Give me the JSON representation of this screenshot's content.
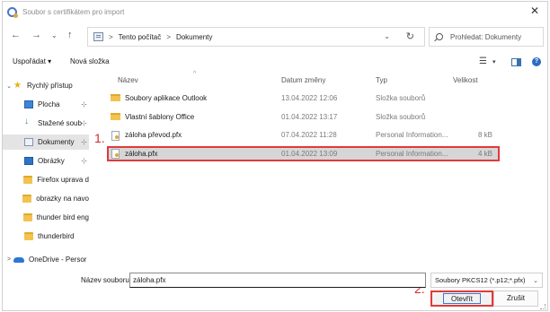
{
  "window": {
    "title": "Soubor s certifikátem pro import",
    "close_glyph": "✕"
  },
  "nav": {
    "back": "←",
    "forward": "→",
    "recent": "⌄",
    "up": "↑",
    "address": {
      "crumb_sep_1": ">",
      "part_1": "Tento počítač",
      "crumb_sep_2": ">",
      "part_2": "Dokumenty",
      "dropdown": "⌄",
      "refresh": "↻"
    },
    "search": {
      "placeholder": "Prohledat: Dokumenty"
    }
  },
  "toolbar": {
    "organize": "Uspořádat ▾",
    "new_folder": "Nová složka",
    "view_glyph": "☰",
    "view_chev": "▾",
    "help_glyph": "?"
  },
  "sidebar": {
    "items": [
      {
        "label": "Rychlý přístup",
        "chev": "⌄",
        "icon": "star-icon"
      },
      {
        "label": "Plocha",
        "icon": "desktop-icon",
        "pin": "📌"
      },
      {
        "label": "Stažené soub",
        "icon": "download-icon",
        "pin": "📌"
      },
      {
        "label": "Dokumenty",
        "icon": "documents-icon",
        "pin": "📌",
        "selected": true
      },
      {
        "label": "Obrázky",
        "icon": "pictures-icon",
        "pin": "📌"
      },
      {
        "label": "Firefox uprava d",
        "icon": "folder-icon"
      },
      {
        "label": "obrazky na navo",
        "icon": "folder-icon"
      },
      {
        "label": "thunder bird eng",
        "icon": "folder-icon"
      },
      {
        "label": "thunderbird",
        "icon": "folder-icon"
      },
      {
        "label": "OneDrive - Persor",
        "chev": ">",
        "icon": "cloud-icon"
      }
    ]
  },
  "columns": {
    "name": "Název",
    "date": "Datum změny",
    "type": "Typ",
    "size": "Velikost",
    "sort_caret": "^"
  },
  "files": [
    {
      "name": "Soubory aplikace Outlook",
      "date": "13.04.2022 12:06",
      "type": "Složka souborů",
      "size": "",
      "icon": "folder-icon"
    },
    {
      "name": "Vlastní šablony Office",
      "date": "01.04.2022 13:17",
      "type": "Složka souborů",
      "size": "",
      "icon": "folder-icon"
    },
    {
      "name": "záloha převod.pfx",
      "date": "07.04.2022 11:28",
      "type": "Personal Information...",
      "size": "8 kB",
      "icon": "certificate-icon"
    },
    {
      "name": "záloha.pfx",
      "date": "01.04.2022 13:09",
      "type": "Personal Information...",
      "size": "4 kB",
      "icon": "certificate-icon",
      "selected": true
    }
  ],
  "annotations": {
    "step1": "1.",
    "step2": "2."
  },
  "bottom": {
    "filename_label": "Název souboru:",
    "filename_value": "záloha.pfx",
    "filetype_value": "Soubory PKCS12 (*.p12;*.pfx)",
    "filetype_chev": "⌄",
    "open_button": "Otevřít",
    "cancel_button": "Zrušit"
  }
}
